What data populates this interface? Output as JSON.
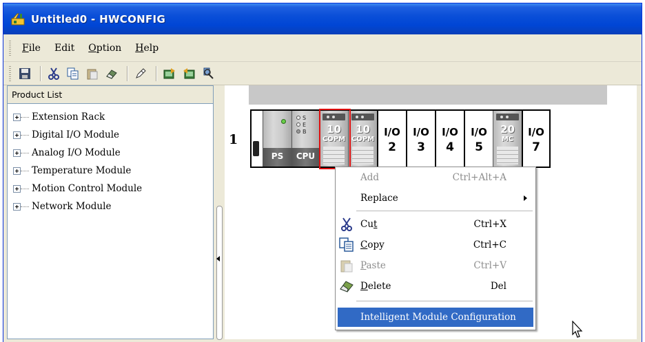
{
  "window": {
    "title": "Untitled0 - HWCONFIG"
  },
  "menubar": {
    "items": [
      {
        "label": "File",
        "mnemonic": "F",
        "rest": "ile"
      },
      {
        "label": "Edit",
        "mnemonic": "",
        "rest": "Edit"
      },
      {
        "label": "Option",
        "mnemonic": "O",
        "rest": "ption"
      },
      {
        "label": "Help",
        "mnemonic": "H",
        "rest": "elp"
      }
    ]
  },
  "toolbar": {
    "buttons": [
      "save-icon",
      "cut-icon",
      "copy-icon",
      "paste-icon",
      "eraser-icon",
      "pen-icon",
      "upload-icon",
      "download-icon",
      "scan-icon"
    ]
  },
  "product_list": {
    "header": "Product List",
    "items": [
      "Extension Rack",
      "Digital I/O Module",
      "Analog I/O Module",
      "Temperature Module",
      "Motion Control Module",
      "Network Module"
    ]
  },
  "rack": {
    "number": "1",
    "modules": [
      {
        "type": "PS",
        "label": "PS"
      },
      {
        "type": "CPU",
        "label": "CPU",
        "leds": [
          "S",
          "E",
          "B"
        ]
      },
      {
        "type": "module",
        "big": "10",
        "small": "COPM",
        "selected": true
      },
      {
        "type": "module",
        "big": "10",
        "small": "COPM",
        "selected": false
      },
      {
        "type": "io",
        "label": "I/O",
        "num": "2"
      },
      {
        "type": "io",
        "label": "I/O",
        "num": "3"
      },
      {
        "type": "io",
        "label": "I/O",
        "num": "4"
      },
      {
        "type": "io",
        "label": "I/O",
        "num": "5"
      },
      {
        "type": "module",
        "big": "20",
        "small": "MC",
        "selected": false
      },
      {
        "type": "io",
        "label": "I/O",
        "num": "7"
      }
    ]
  },
  "context_menu": {
    "add": {
      "label": "Add",
      "shortcut": "Ctrl+Alt+A"
    },
    "replace": {
      "label": "Replace"
    },
    "cut": {
      "pre": "Cu",
      "mn": "t",
      "post": "",
      "shortcut": "Ctrl+X"
    },
    "copy": {
      "pre": "",
      "mn": "C",
      "post": "opy",
      "shortcut": "Ctrl+C"
    },
    "paste": {
      "pre": "",
      "mn": "P",
      "post": "aste",
      "shortcut": "Ctrl+V"
    },
    "delete": {
      "pre": "",
      "mn": "D",
      "post": "elete",
      "shortcut": "Del"
    },
    "intelligent": {
      "label": "Intelligent Module Configuration"
    }
  },
  "colors": {
    "title_bar": "#0046d5",
    "highlight": "#316ac5",
    "selected_border": "#e01010"
  }
}
